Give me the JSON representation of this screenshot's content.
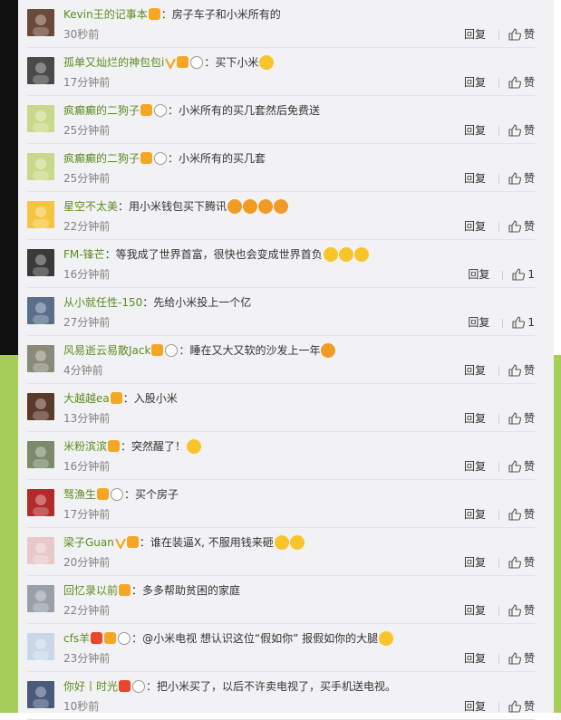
{
  "actions": {
    "reply_label": "回复",
    "like_label": "赞"
  },
  "comments": [
    {
      "user": "Kevin王的记事本",
      "text": "：房子车子和小米所有的",
      "time": "30秒前",
      "like": "赞",
      "badges": [
        "orange"
      ],
      "emojis": []
    },
    {
      "user": "孤单又灿烂的神包包i",
      "text": "：买下小米",
      "time": "17分钟前",
      "like": "赞",
      "badges": [
        "vip",
        "orange",
        "panda"
      ],
      "emojis": [
        "yellow"
      ]
    },
    {
      "user": "疯癫癫的二狗子",
      "text": "：小米所有的买几套然后免费送",
      "time": "25分钟前",
      "like": "赞",
      "badges": [
        "orange",
        "panda"
      ],
      "emojis": []
    },
    {
      "user": "疯癫癫的二狗子",
      "text": "：小米所有的买几套",
      "time": "25分钟前",
      "like": "赞",
      "badges": [
        "orange",
        "panda"
      ],
      "emojis": []
    },
    {
      "user": "星空不太美",
      "text": "：用小米钱包买下腾讯",
      "time": "22分钟前",
      "like": "赞",
      "badges": [],
      "emojis": [
        "orange",
        "orange",
        "orange",
        "orange"
      ]
    },
    {
      "user": "FM-锋芒",
      "text": "：等我成了世界首富，很快也会变成世界首负",
      "time": "16分钟前",
      "like": "1",
      "badges": [],
      "emojis": [
        "yellow",
        "yellow",
        "yellow"
      ]
    },
    {
      "user": "从小就任性-150",
      "text": "：先给小米投上一个亿",
      "time": "27分钟前",
      "like": "1",
      "badges": [],
      "emojis": []
    },
    {
      "user": "风易逝云易散Jack",
      "text": "：睡在又大又软的沙发上一年",
      "time": "4分钟前",
      "like": "赞",
      "badges": [
        "orange",
        "panda"
      ],
      "emojis": [
        "orange"
      ]
    },
    {
      "user": "大越越ea",
      "text": "：入股小米",
      "time": "13分钟前",
      "like": "赞",
      "badges": [
        "orange"
      ],
      "emojis": []
    },
    {
      "user": "米粉滨滨",
      "text": "：突然醒了！",
      "time": "16分钟前",
      "like": "赞",
      "badges": [
        "orange"
      ],
      "emojis": [
        "yellow"
      ]
    },
    {
      "user": "驽漁生",
      "text": "：买个房子",
      "time": "17分钟前",
      "like": "赞",
      "badges": [
        "orange",
        "panda"
      ],
      "emojis": []
    },
    {
      "user": "梁子Guan",
      "text": "：谁在装逼X, 不服用钱来砸",
      "time": "20分钟前",
      "like": "赞",
      "badges": [
        "vip",
        "orange"
      ],
      "emojis": [
        "yellow",
        "yellow"
      ]
    },
    {
      "user": "回忆录以前",
      "text": "：多多帮助贫困的家庭",
      "time": "22分钟前",
      "like": "赞",
      "badges": [
        "orange"
      ],
      "emojis": []
    },
    {
      "user": "cfs羊",
      "text": "：@小米电视  想认识这位“假如你”  报假如你的大腿",
      "time": "23分钟前",
      "like": "赞",
      "badges": [
        "red",
        "orange",
        "panda"
      ],
      "emojis": [
        "yellow"
      ]
    },
    {
      "user": "你好丨时光",
      "text": "：把小米买了，以后不许卖电视了，买手机送电视。",
      "time": "10秒前",
      "like": "赞",
      "badges": [
        "red",
        "panda"
      ],
      "emojis": []
    }
  ]
}
